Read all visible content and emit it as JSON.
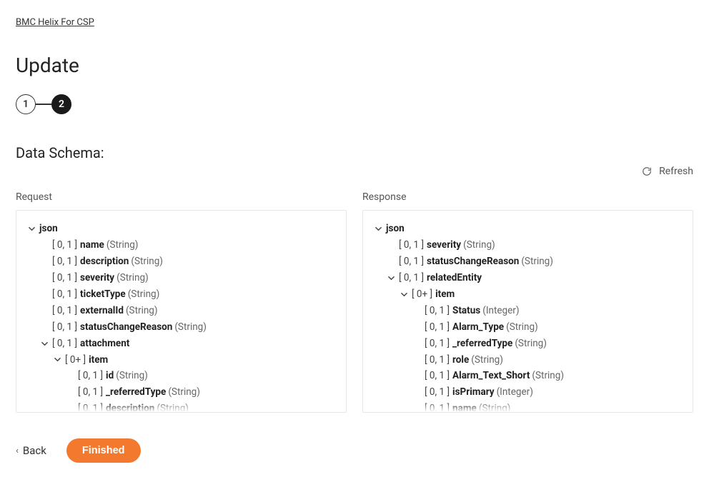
{
  "breadcrumb": "BMC Helix For CSP",
  "page_title": "Update",
  "steps": {
    "step1": "1",
    "step2": "2"
  },
  "section_title": "Data Schema:",
  "refresh_label": "Refresh",
  "columns": {
    "request_label": "Request",
    "response_label": "Response"
  },
  "request_tree": [
    {
      "indent": 0,
      "caret": true,
      "name": "json",
      "type": "",
      "card": ""
    },
    {
      "indent": 1,
      "caret": false,
      "card": "[ 0, 1 ]",
      "name": "name",
      "type": "(String)"
    },
    {
      "indent": 1,
      "caret": false,
      "card": "[ 0, 1 ]",
      "name": "description",
      "type": "(String)"
    },
    {
      "indent": 1,
      "caret": false,
      "card": "[ 0, 1 ]",
      "name": "severity",
      "type": "(String)"
    },
    {
      "indent": 1,
      "caret": false,
      "card": "[ 0, 1 ]",
      "name": "ticketType",
      "type": "(String)"
    },
    {
      "indent": 1,
      "caret": false,
      "card": "[ 0, 1 ]",
      "name": "externalId",
      "type": "(String)"
    },
    {
      "indent": 1,
      "caret": false,
      "card": "[ 0, 1 ]",
      "name": "statusChangeReason",
      "type": "(String)"
    },
    {
      "indent": 1,
      "caret": true,
      "card": "[ 0, 1 ]",
      "name": "attachment",
      "type": ""
    },
    {
      "indent": 2,
      "caret": true,
      "card": "[ 0+ ]",
      "name": "item",
      "type": ""
    },
    {
      "indent": 3,
      "caret": false,
      "card": "[ 0, 1 ]",
      "name": "id",
      "type": "(String)"
    },
    {
      "indent": 3,
      "caret": false,
      "card": "[ 0, 1 ]",
      "name": "_referredType",
      "type": "(String)"
    },
    {
      "indent": 3,
      "caret": false,
      "card": "[ 0, 1 ]",
      "name": "description",
      "type": "(String)"
    }
  ],
  "response_tree": [
    {
      "indent": 0,
      "caret": true,
      "name": "json",
      "type": "",
      "card": ""
    },
    {
      "indent": 1,
      "caret": false,
      "card": "[ 0, 1 ]",
      "name": "severity",
      "type": "(String)"
    },
    {
      "indent": 1,
      "caret": false,
      "card": "[ 0, 1 ]",
      "name": "statusChangeReason",
      "type": "(String)"
    },
    {
      "indent": 1,
      "caret": true,
      "card": "[ 0, 1 ]",
      "name": "relatedEntity",
      "type": ""
    },
    {
      "indent": 2,
      "caret": true,
      "card": "[ 0+ ]",
      "name": "item",
      "type": ""
    },
    {
      "indent": 3,
      "caret": false,
      "card": "[ 0, 1 ]",
      "name": "Status",
      "type": "(Integer)"
    },
    {
      "indent": 3,
      "caret": false,
      "card": "[ 0, 1 ]",
      "name": "Alarm_Type",
      "type": "(String)"
    },
    {
      "indent": 3,
      "caret": false,
      "card": "[ 0, 1 ]",
      "name": "_referredType",
      "type": "(String)"
    },
    {
      "indent": 3,
      "caret": false,
      "card": "[ 0, 1 ]",
      "name": "role",
      "type": "(String)"
    },
    {
      "indent": 3,
      "caret": false,
      "card": "[ 0, 1 ]",
      "name": "Alarm_Text_Short",
      "type": "(String)"
    },
    {
      "indent": 3,
      "caret": false,
      "card": "[ 0, 1 ]",
      "name": "isPrimary",
      "type": "(Integer)"
    },
    {
      "indent": 3,
      "caret": false,
      "card": "[ 0, 1 ]",
      "name": "name",
      "type": "(String)"
    }
  ],
  "footer": {
    "back": "Back",
    "finished": "Finished"
  }
}
